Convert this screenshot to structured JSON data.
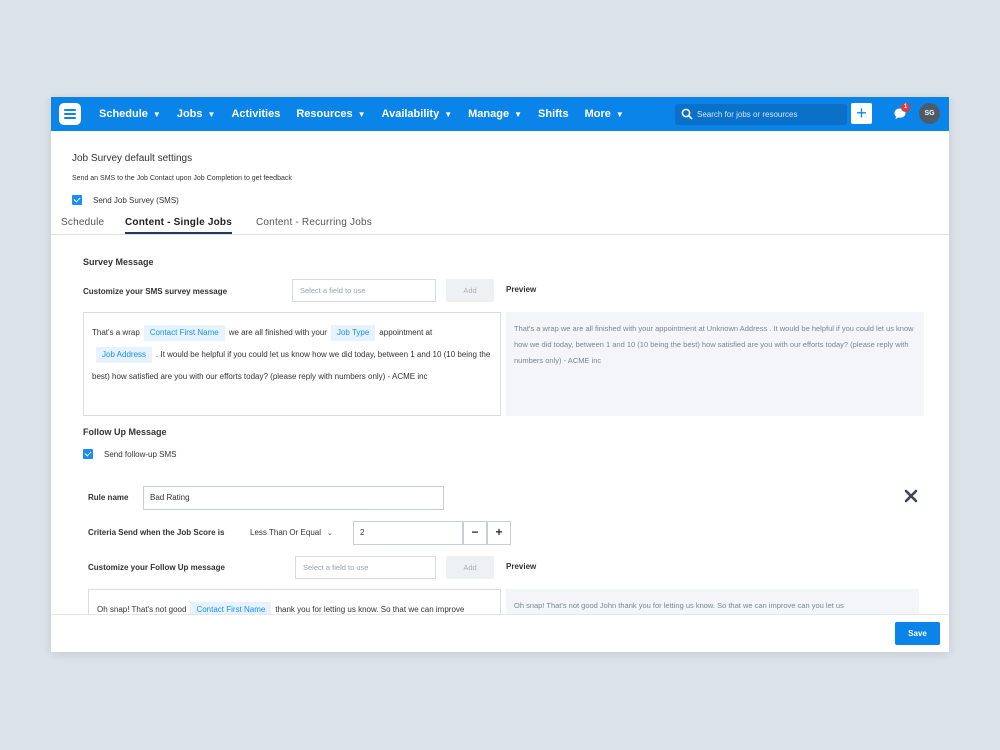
{
  "nav": {
    "items": [
      {
        "label": "Schedule",
        "has_menu": true
      },
      {
        "label": "Jobs",
        "has_menu": true
      },
      {
        "label": "Activities",
        "has_menu": false
      },
      {
        "label": "Resources",
        "has_menu": true
      },
      {
        "label": "Availability",
        "has_menu": true
      },
      {
        "label": "Manage",
        "has_menu": true
      },
      {
        "label": "Shifts",
        "has_menu": false
      },
      {
        "label": "More",
        "has_menu": true
      }
    ],
    "search_placeholder": "Search for jobs or resources",
    "notification_count": "1",
    "avatar_initials": "SG"
  },
  "settings": {
    "title": "Job Survey default settings",
    "description": "Send an SMS to the Job Contact upon Job Completion to get feedback",
    "send_survey_label": "Send Job Survey (SMS)",
    "send_survey_checked": true
  },
  "tabs": [
    {
      "label": "Schedule",
      "active": false
    },
    {
      "label": "Content - Single Jobs",
      "active": true
    },
    {
      "label": "Content - Recurring Jobs",
      "active": false
    }
  ],
  "survey": {
    "section_title": "Survey Message",
    "customize_label": "Customize your SMS survey message",
    "select_placeholder": "Select a field to use",
    "add_label": "Add",
    "preview_label": "Preview",
    "message": {
      "text1": "That's a wrap",
      "tag1": "Contact First Name",
      "text2": "we are all finished with your",
      "tag2": "Job Type",
      "text3": "appointment at",
      "tag3": "Job Address",
      "text4": ". It would be helpful if you could let us know how we did today, between 1 and 10 (10 being the best) how satisfied are you with our efforts today? (please reply with numbers only) - ACME inc"
    },
    "preview_text": "That's a wrap we are all finished with your appointment at Unknown Address . It would be helpful if you could let us know how we did today, between 1 and 10 (10 being the best) how satisfied are you with our efforts today? (please reply with numbers only) - ACME inc"
  },
  "followup": {
    "section_title": "Follow Up Message",
    "send_followup_label": "Send follow-up SMS",
    "send_followup_checked": true,
    "rule_name_label": "Rule name",
    "rule_name_value": "Bad Rating",
    "criteria_label": "Criteria Send when the Job Score is",
    "criteria_operator": "Less Than Or Equal",
    "criteria_value": "2",
    "minus_label": "−",
    "plus_label": "+",
    "customize_label": "Customize your Follow Up message",
    "select_placeholder": "Select a field to use",
    "add_label": "Add",
    "preview_label": "Preview",
    "message": {
      "text1": "Oh snap! That's not good",
      "tag1": "Contact First Name",
      "text2": "thank you for letting us know. So that we can improve"
    },
    "preview_text": "Oh snap! That's not good John thank you for letting us know. So that we can improve can you let us"
  },
  "footer": {
    "save_label": "Save"
  },
  "colors": {
    "brand_blue": "#0a84e8",
    "tag_bg": "#e6f3fd",
    "preview_bg": "#f3f5f8"
  }
}
